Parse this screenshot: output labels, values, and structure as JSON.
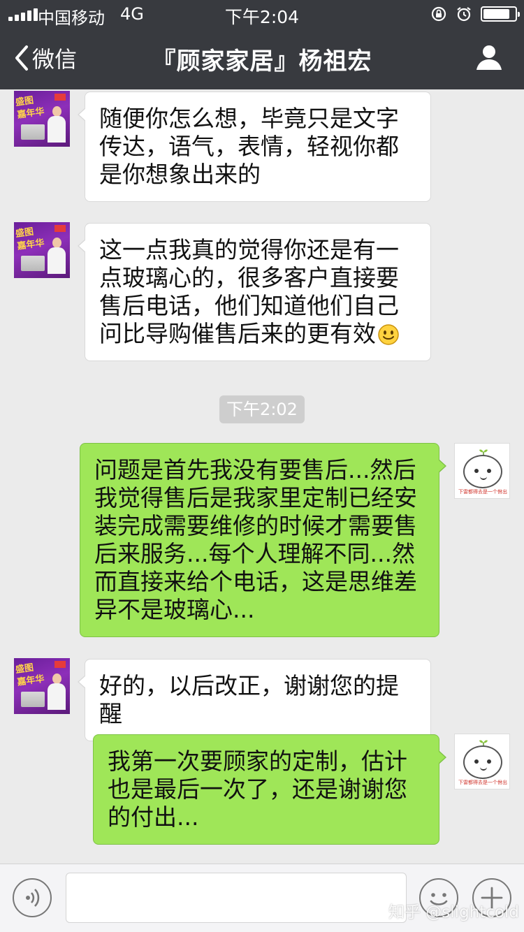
{
  "status_bar": {
    "carrier": "中国移动",
    "network": "4G",
    "time": "下午2:04",
    "icons": [
      "signal-icon",
      "rotation-lock-icon",
      "alarm-icon",
      "battery-icon"
    ],
    "battery_level": 0.85
  },
  "nav": {
    "back_label": "微信",
    "title": "『顾家家居』杨祖宏",
    "profile_icon": "person-icon"
  },
  "messages": [
    {
      "side": "in",
      "text": "随便你怎么想，毕竟只是文字传达，语气，表情，轻视你都是你想象出来的"
    },
    {
      "side": "in",
      "text": "这一点我真的觉得你还是有一点玻璃心的，很多客户直接要售后电话，他们知道他们自己问比导购催售后来的更有效",
      "emoji": "smile-emoji"
    },
    {
      "side": "out",
      "text": "问题是首先我没有要售后...然后我觉得售后是我家里定制已经安装完成需要维修的时候才需要售后来服务...每个人理解不同...然而直接来给个电话，这是思维差异不是玻璃心..."
    },
    {
      "side": "in",
      "text": "好的，以后改正，谢谢您的提醒"
    },
    {
      "side": "out",
      "text": "我第一次要顾家的定制，估计也是最后一次了，还是谢谢您的付出..."
    }
  ],
  "timestamp": "下午2:02",
  "avatars": {
    "contact": {
      "promo_text": "盛图\n嘉年华"
    },
    "self": {
      "caption": "下雷都得去是一个佾出"
    }
  },
  "input_bar": {
    "voice_icon": "voice-icon",
    "emoji_icon": "emoji-icon",
    "plus_icon": "plus-icon"
  },
  "watermark": "知乎 @slightcold",
  "colors": {
    "nav_background": "#383a3f",
    "chat_background": "#ebebeb",
    "outgoing_bubble": "#9fe658",
    "incoming_bubble": "#ffffff"
  }
}
